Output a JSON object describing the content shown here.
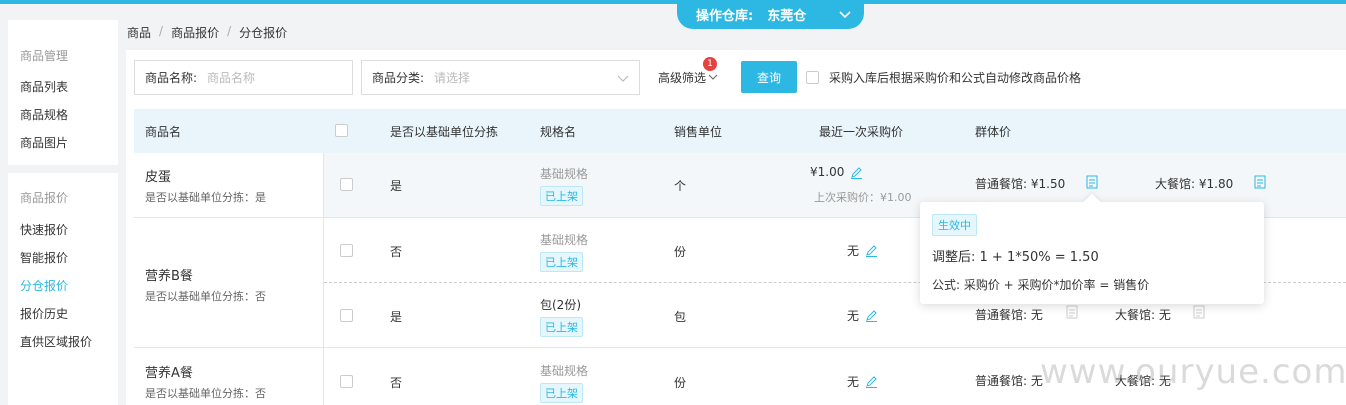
{
  "header": {
    "warehouse_label": "操作仓库:",
    "warehouse_value": "东莞仓"
  },
  "breadcrumb": [
    "商品",
    "商品报价",
    "分仓报价"
  ],
  "sidebar": {
    "group1": "商品管理",
    "group1_items": [
      "商品列表",
      "商品规格",
      "商品图片"
    ],
    "group2": "商品报价",
    "group2_items": [
      "快速报价",
      "智能报价",
      "分仓报价",
      "报价历史",
      "直供区域报价"
    ],
    "active": "分仓报价"
  },
  "filters": {
    "name_label": "商品名称:",
    "name_placeholder": "商品名称",
    "category_label": "商品分类:",
    "category_placeholder": "请选择",
    "advanced_label": "高级筛选",
    "advanced_badge": "1",
    "query_label": "查询",
    "auto_label": "采购入库后根据采购价和公式自动修改商品价格"
  },
  "table": {
    "headers": [
      "商品名",
      "是否以基础单位分拣",
      "规格名",
      "销售单位",
      "最近一次采购价",
      "群体价"
    ],
    "products": [
      {
        "name": "皮蛋",
        "sub": "是否以基础单位分拣：是"
      },
      {
        "name": "营养B餐",
        "sub": "是否以基础单位分拣：否"
      },
      {
        "name": "营养A餐",
        "sub": "是否以基础单位分拣：否"
      }
    ],
    "rows": [
      {
        "base_sort": "是",
        "spec": "基础规格",
        "tag": "已上架",
        "unit": "个",
        "price": "¥1.00",
        "last_price": "上次采购价：¥1.00",
        "g1": "普通餐馆: ¥1.50",
        "g2": "大餐馆: ¥1.80"
      },
      {
        "base_sort": "否",
        "spec": "基础规格",
        "tag": "已上架",
        "unit": "份",
        "price": "无",
        "g1": "",
        "g2": ""
      },
      {
        "base_sort": "是",
        "spec": "包(2份)",
        "tag": "已上架",
        "unit": "包",
        "price": "无",
        "g1": "普通餐馆: 无",
        "g2": "大餐馆: 无"
      },
      {
        "base_sort": "否",
        "spec": "基础规格",
        "tag": "已上架",
        "unit": "份",
        "price": "无",
        "g1": "普通餐馆: 无",
        "g2": "大餐馆: 无"
      }
    ]
  },
  "popup": {
    "status": "生效中",
    "line1": "调整后:  1 + 1*50% = 1.50",
    "line2": "公式:  采购价 + 采购价*加价率 = 销售价"
  },
  "watermark": "www.ouryue.com",
  "colors": {
    "accent": "#2db7e3",
    "badge": "#e64340"
  }
}
